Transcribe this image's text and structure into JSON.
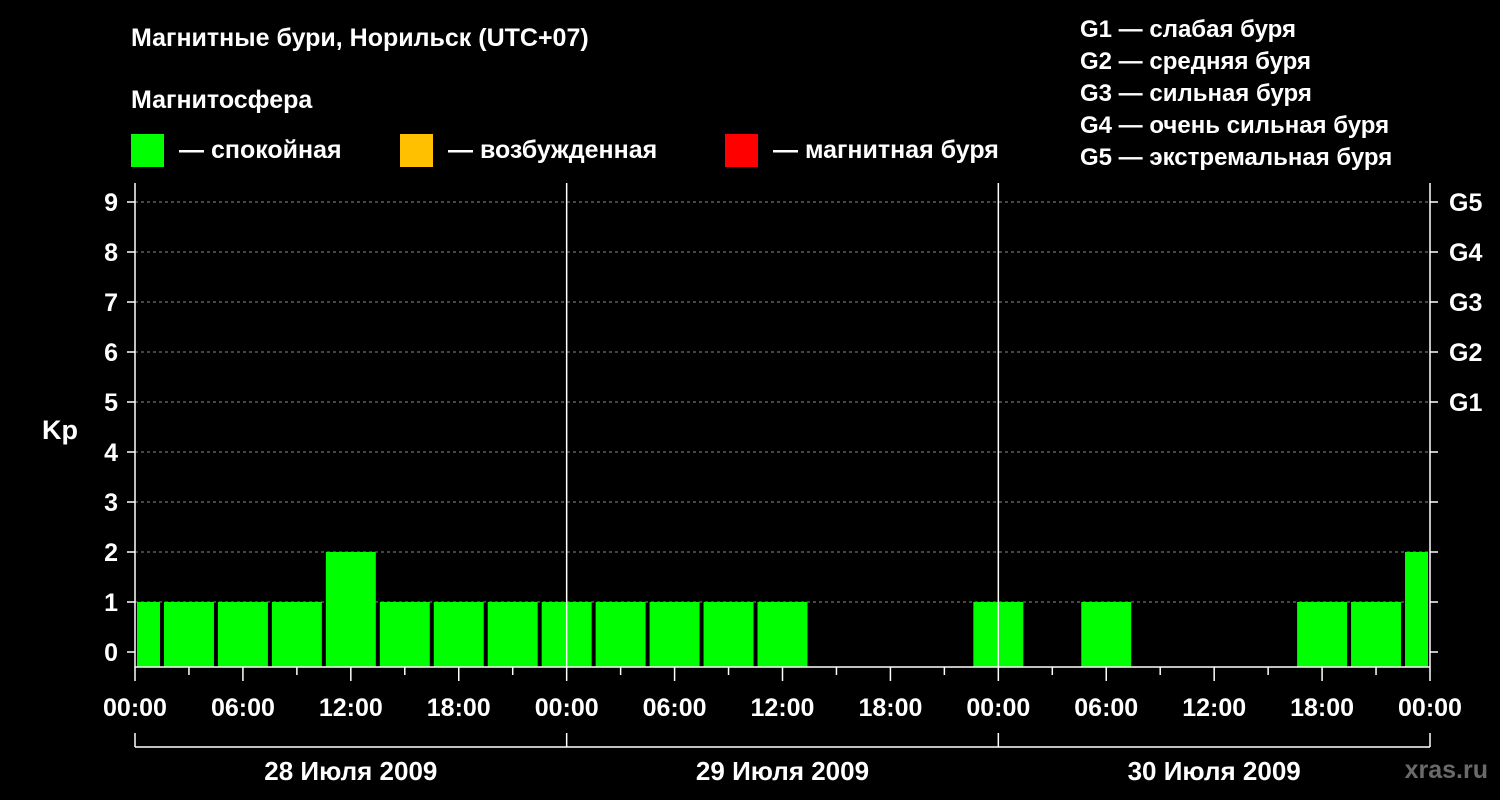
{
  "title": "Магнитные бури, Норильск (UTC+07)",
  "subtitle": "Магнитосфера",
  "legend": [
    {
      "label": "— спокойная",
      "color": "#00ff00"
    },
    {
      "label": "— возбужденная",
      "color": "#ffc000"
    },
    {
      "label": "— магнитная буря",
      "color": "#ff0000"
    }
  ],
  "g_legend": [
    "G1 — слабая буря",
    "G2 — средняя буря",
    "G3 — сильная буря",
    "G4 — очень сильная буря",
    "G5 — экстремальная буря"
  ],
  "site": "xras.ru",
  "chart_data": {
    "type": "bar",
    "ylabel": "Kp",
    "ylim": [
      0,
      9
    ],
    "y_ticks": [
      "0",
      "1",
      "2",
      "3",
      "4",
      "5",
      "6",
      "7",
      "8",
      "9"
    ],
    "right_ticks": [
      {
        "value": 5,
        "label": "G1"
      },
      {
        "value": 6,
        "label": "G2"
      },
      {
        "value": 7,
        "label": "G3"
      },
      {
        "value": 8,
        "label": "G4"
      },
      {
        "value": 9,
        "label": "G5"
      }
    ],
    "x_tick_labels": [
      "00:00",
      "06:00",
      "12:00",
      "18:00",
      "00:00",
      "06:00",
      "12:00",
      "18:00",
      "00:00",
      "06:00",
      "12:00",
      "18:00",
      "00:00"
    ],
    "days": [
      "28 Июля 2009",
      "29 Июля 2009",
      "30 Июля 2009"
    ],
    "grid": true,
    "series": [
      {
        "color": "#00ff00",
        "values": [
          1,
          1,
          1,
          1,
          2,
          1,
          1,
          1,
          1,
          1,
          1,
          1,
          1,
          0,
          0,
          0,
          1,
          0,
          1,
          0,
          0,
          0,
          1,
          1,
          2
        ]
      }
    ]
  }
}
